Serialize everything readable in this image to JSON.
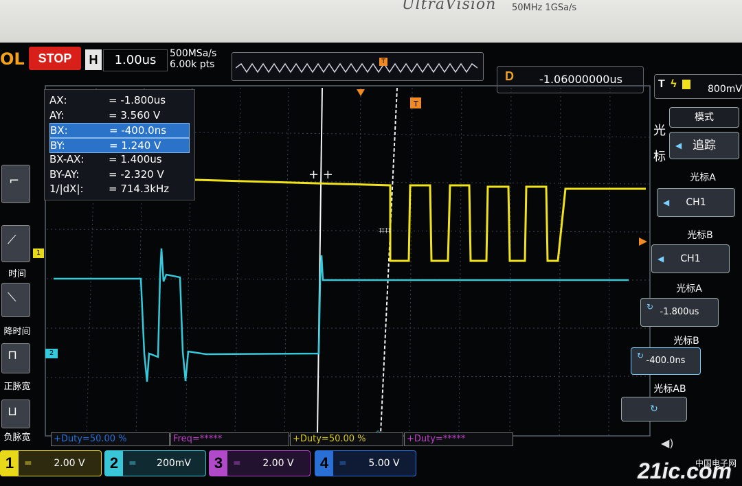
{
  "bezel": {
    "brand": "UltraVision",
    "spec": "50MHz  1GSa/s"
  },
  "topbar": {
    "rigol": "OL",
    "run_state": "STOP",
    "h_label": "H",
    "timebase": "1.00us",
    "sample_rate": "500MSa/s",
    "points": "6.00k pts",
    "trig_marker": "T",
    "delay_label": "D",
    "delay_value": "-1.06000000us",
    "trig_label": "T",
    "trig_level": "800mV"
  },
  "cursor_readout": [
    {
      "key": "AX:",
      "value": "=  -1.800us",
      "highlight": false
    },
    {
      "key": "AY:",
      "value": "=  3.560 V",
      "highlight": false
    },
    {
      "key": "BX:",
      "value": "=  -400.0ns",
      "highlight": true
    },
    {
      "key": "BY:",
      "value": "=  1.240 V",
      "highlight": true
    },
    {
      "key": "BX-AX:",
      "value": "=  1.400us",
      "highlight": false
    },
    {
      "key": "BY-AY:",
      "value": "=  -2.320 V",
      "highlight": false
    },
    {
      "key": "1/|dX|:",
      "value": "=  714.3kHz",
      "highlight": false
    }
  ],
  "left_menu": [
    {
      "label": "时间",
      "icon": "rise-time-icon"
    },
    {
      "label": "降时间",
      "icon": "fall-time-icon"
    },
    {
      "label": "正脉宽",
      "icon": "positive-pulse-icon"
    },
    {
      "label": "负脉宽",
      "icon": "negative-pulse-icon"
    }
  ],
  "right_menu": {
    "mode_title": "模式",
    "side_title": "光标",
    "mode_value": "追踪",
    "cursor_a_title": "光标A",
    "cursor_a_source": "CH1",
    "cursor_b_title": "光标B",
    "cursor_b_source": "CH1",
    "cursor_a_pos_title": "光标A",
    "cursor_a_pos": "-1.800us",
    "cursor_b_pos_title": "光标B",
    "cursor_b_pos": "-400.0ns",
    "cursor_ab_title": "光标AB"
  },
  "measure_bar": [
    {
      "text": "+Duty=50.00 %",
      "color": "#2a6fd6"
    },
    {
      "text": "Freq=*****",
      "color": "#c040c8"
    },
    {
      "text": "+Duty=50.00 %",
      "color": "#d8c81a"
    },
    {
      "text": "+Duty=*****",
      "color": "#c040c8"
    }
  ],
  "channels": [
    {
      "num": "1",
      "scale": "2.00 V",
      "color": "#e8d81a",
      "bg": "#2d2a10"
    },
    {
      "num": "2",
      "scale": "200mV",
      "color": "#39c6d6",
      "bg": "#0f2a30"
    },
    {
      "num": "3",
      "scale": "2.00 V",
      "color": "#b04ac8",
      "bg": "#221230"
    },
    {
      "num": "4",
      "scale": "5.00 V",
      "color": "#2a6fd6",
      "bg": "#0f1a34"
    }
  ],
  "trace_markers": {
    "ch1": "1",
    "ch2": "2"
  },
  "watermark": {
    "logo": "21ic.com",
    "cn": "中国电子网"
  },
  "colors": {
    "ch1": "#f0e31c",
    "ch2": "#35c9dc",
    "grid": "#4a5260"
  }
}
